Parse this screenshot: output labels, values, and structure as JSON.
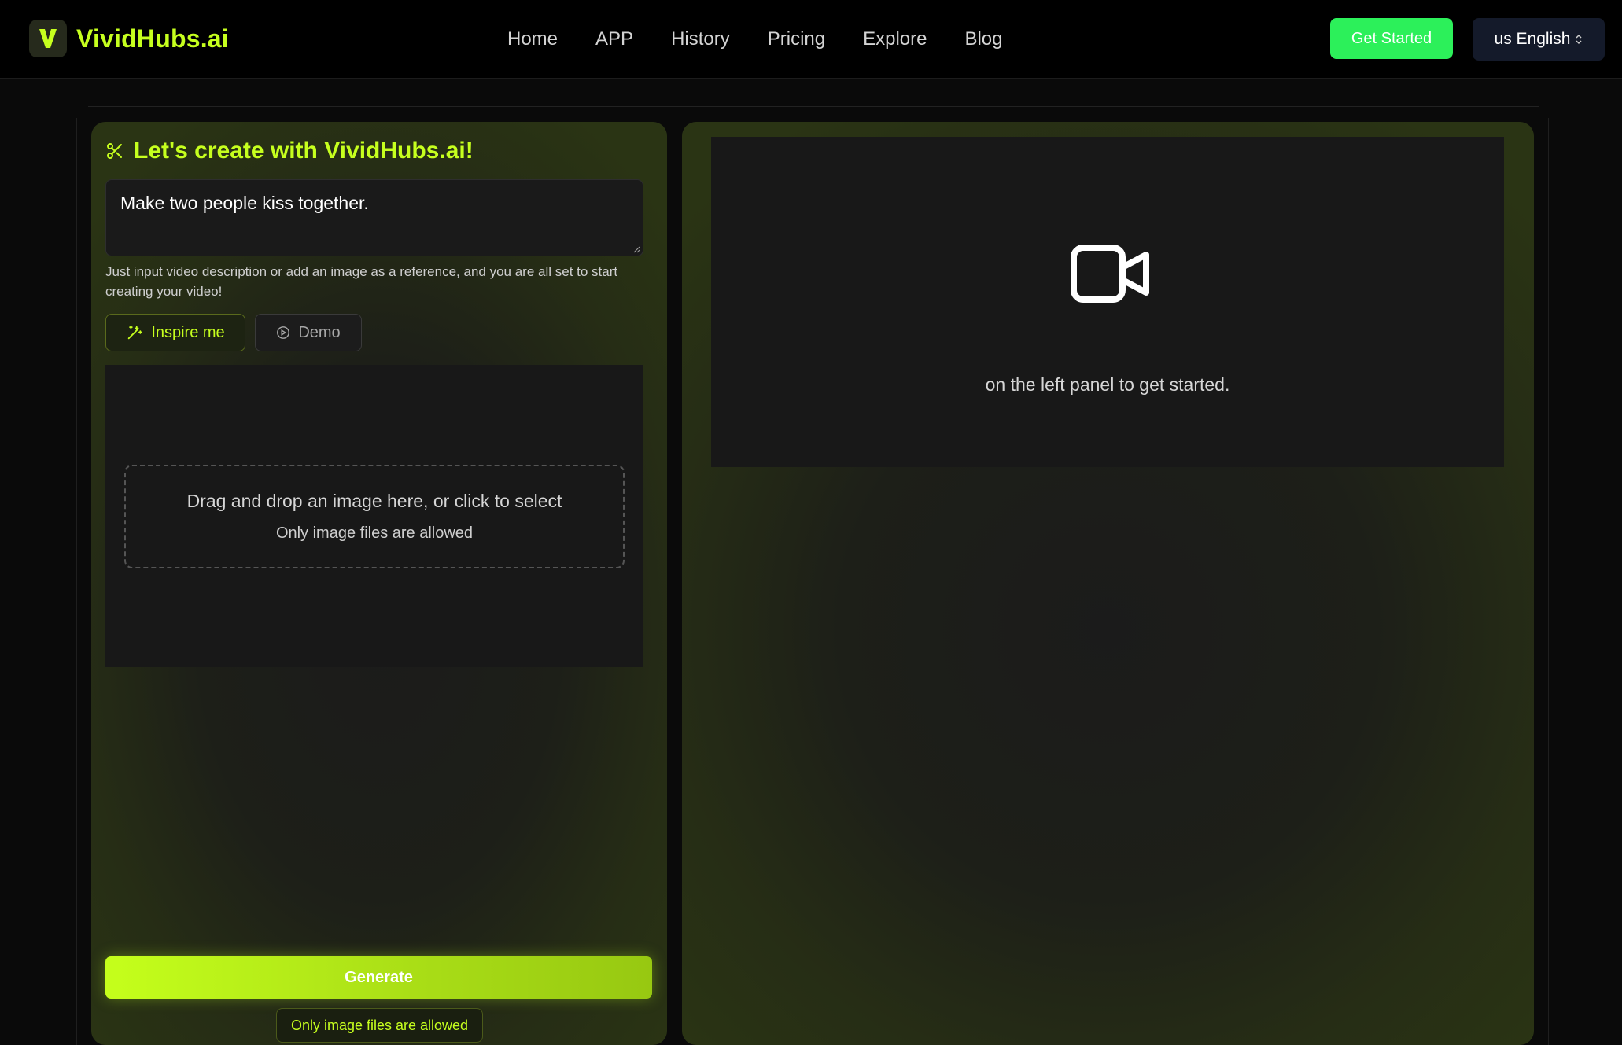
{
  "header": {
    "brand": "VividHubs.ai",
    "logo_letter": "V",
    "nav": [
      "Home",
      "APP",
      "History",
      "Pricing",
      "Explore",
      "Blog"
    ],
    "get_started": "Get Started",
    "language": "us English"
  },
  "left_panel": {
    "title": "Let's create with VividHubs.ai!",
    "prompt_value": "Make two people kiss together.",
    "hint": "Just input video description or add an image as a reference, and you are all set to start creating your video!",
    "inspire_label": "Inspire me",
    "demo_label": "Demo",
    "dropzone_title": "Drag and drop an image here, or click to select",
    "dropzone_sub": "Only image files are allowed",
    "generate_label": "Generate",
    "notice": "Only image files are allowed"
  },
  "right_panel": {
    "preview_text": "on the left panel to get started."
  },
  "colors": {
    "accent": "#c6ff1e",
    "get_started_bg": "#2cf05a",
    "language_bg": "#141a2a",
    "page_bg": "#0a0a0a"
  },
  "icons": {
    "brand": "v-logo-icon",
    "title": "scissors-icon",
    "inspire": "magic-wand-icon",
    "demo": "play-circle-icon",
    "preview": "video-camera-icon",
    "language": "chevron-up-down-icon"
  }
}
